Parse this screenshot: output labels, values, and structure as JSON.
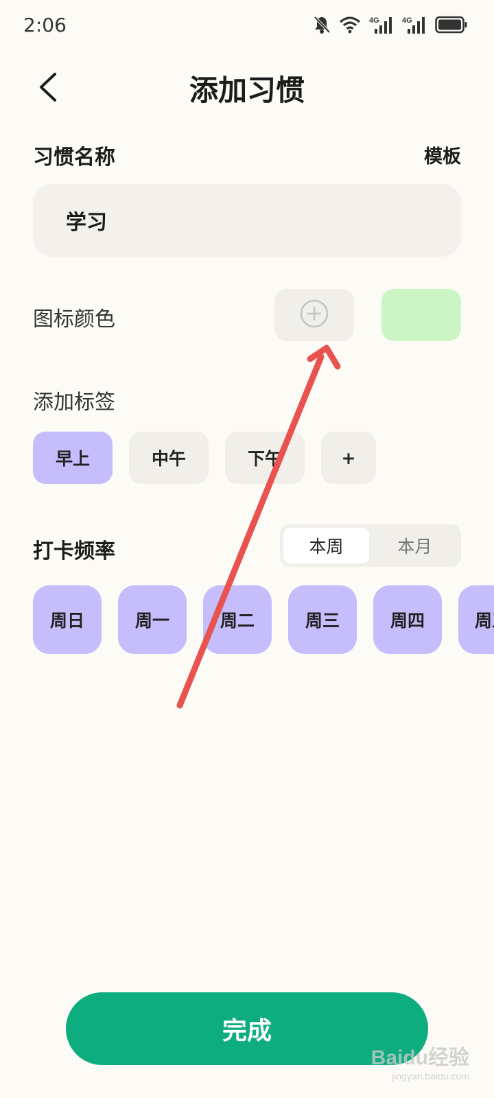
{
  "status_bar": {
    "time": "2:06",
    "icons": [
      "bell-muted-icon",
      "wifi-icon",
      "signal-4g-icon",
      "signal-4g-icon",
      "battery-icon"
    ],
    "network_label": "4G"
  },
  "header": {
    "title": "添加习惯",
    "back_icon": "chevron-left-icon"
  },
  "habit_name": {
    "label": "习惯名称",
    "template_link": "模板",
    "value": "学习"
  },
  "icon_color": {
    "label": "图标颜色",
    "add_icon": "plus-circle-icon",
    "swatch_color": "#ccf5c6"
  },
  "tags": {
    "label": "添加标签",
    "items": [
      {
        "label": "早上",
        "selected": true
      },
      {
        "label": "中午",
        "selected": false
      },
      {
        "label": "下午",
        "selected": false
      },
      {
        "label": "+",
        "selected": false
      }
    ]
  },
  "frequency": {
    "label": "打卡频率",
    "segments": [
      {
        "label": "本周",
        "active": true
      },
      {
        "label": "本月",
        "active": false
      }
    ],
    "days": [
      "周日",
      "周一",
      "周二",
      "周三",
      "周四",
      "周五"
    ]
  },
  "done_button": {
    "label": "完成",
    "color": "#0ead7f"
  },
  "colors": {
    "background": "#fcfbf6",
    "chip_selected": "#c5bdfc",
    "chip_default": "#f0efea",
    "annotation_arrow": "#e8534f"
  },
  "watermark": {
    "main": "Baidu经验",
    "sub": "jingyan.baidu.com"
  }
}
